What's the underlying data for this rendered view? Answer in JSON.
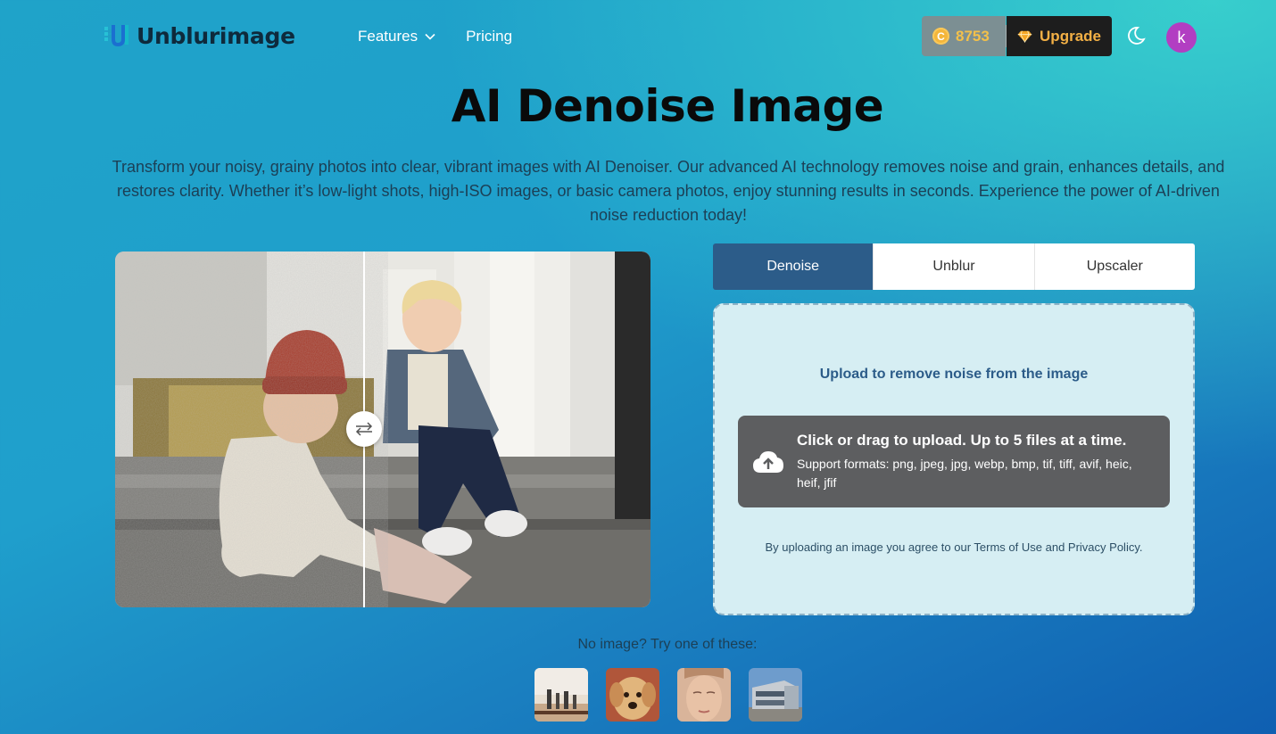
{
  "header": {
    "logo_text": "Unblurimage",
    "nav": [
      {
        "label": "Features",
        "has_dropdown": true
      },
      {
        "label": "Pricing",
        "has_dropdown": false
      }
    ],
    "credits": "8753",
    "coin_glyph": "C",
    "upgrade_label": "Upgrade",
    "avatar_letter": "k"
  },
  "hero": {
    "title": "AI Denoise Image",
    "description": "Transform your noisy, grainy photos into clear, vibrant images with AI Denoiser. Our advanced AI technology removes noise and grain, enhances details, and restores clarity. Whether it’s low-light shots, high-ISO images, or basic camera photos, enjoy stunning results in seconds. Experience the power of AI-driven noise reduction today!"
  },
  "tabs": [
    {
      "label": "Denoise",
      "active": true
    },
    {
      "label": "Unblur",
      "active": false
    },
    {
      "label": "Upscaler",
      "active": false
    }
  ],
  "upload": {
    "heading": "Upload to remove noise from the image",
    "drop_title": "Click or drag to upload. Up to 5 files at a time.",
    "drop_formats": "Support formats: png, jpeg, jpg, webp, bmp, tif, tiff, avif, heic, heif, jfif",
    "agree_prefix": "By uploading an image you agree to our ",
    "terms_link": "Terms of Use",
    "and_text": " and ",
    "privacy_link": "Privacy Policy",
    "agree_suffix": "."
  },
  "samples": {
    "label": "No image? Try one of these:",
    "items": [
      "family-beach",
      "puppy",
      "woman-face",
      "building"
    ]
  },
  "colors": {
    "active_tab": "#2c5c89",
    "upgrade_text": "#f3b045",
    "avatar": "#b23ec2"
  }
}
